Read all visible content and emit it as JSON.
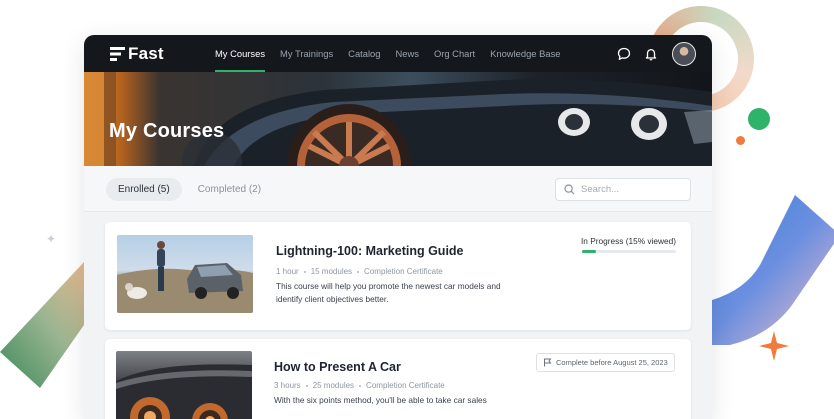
{
  "nav": {
    "logo": "Fast",
    "links": [
      "My Courses",
      "My Trainings",
      "Catalog",
      "News",
      "Org Chart",
      "Knowledge Base"
    ],
    "active_index": 0
  },
  "hero": {
    "title": "My Courses"
  },
  "tabs": [
    {
      "label": "Enrolled (5)",
      "active": true
    },
    {
      "label": "Completed (2)",
      "active": false
    }
  ],
  "search": {
    "placeholder": "Search..."
  },
  "courses": [
    {
      "title": "Lightning-100: Marketing Guide",
      "duration": "1 hour",
      "modules": "15 modules",
      "credential": "Completion Certificate",
      "description": "This course will help you promote the newest car models and identify client objectives better.",
      "status": "In Progress (15% viewed)",
      "progress": 0.15
    },
    {
      "title": "How to Present A Car",
      "duration": "3 hours",
      "modules": "25 modules",
      "credential": "Completion Certificate",
      "description": "With the six points method, you'll be able to take car sales",
      "due": "Complete before August 25, 2023"
    }
  ],
  "colors": {
    "accent": "#2fb36b",
    "nav_bg": "#14181d"
  }
}
